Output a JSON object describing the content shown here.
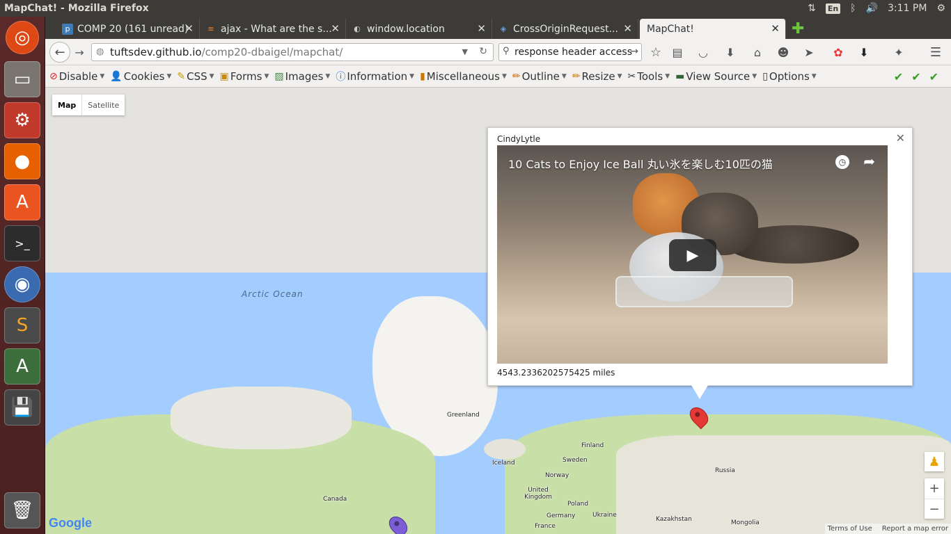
{
  "os": {
    "window_title": "MapChat! - Mozilla Firefox",
    "language": "En",
    "clock": "3:11 PM"
  },
  "tabs": [
    {
      "label": "COMP 20 (161 unread)",
      "icon": "piazza-icon"
    },
    {
      "label": "ajax - What are the s...",
      "icon": "stackoverflow-icon"
    },
    {
      "label": "window.location",
      "icon": "mdn-icon"
    },
    {
      "label": "CrossOriginRequest...",
      "icon": "site-icon"
    },
    {
      "label": "MapChat!",
      "icon": "none"
    }
  ],
  "nav": {
    "url_host": "tuftsdev.github.io",
    "url_path": "/comp20-dbaigel/mapchat/",
    "search_value": "response header access"
  },
  "devbar": {
    "items": [
      "Disable",
      "Cookies",
      "CSS",
      "Forms",
      "Images",
      "Information",
      "Miscellaneous",
      "Outline",
      "Resize",
      "Tools",
      "View Source",
      "Options"
    ]
  },
  "map": {
    "type_map": "Map",
    "type_satellite": "Satellite",
    "labels": {
      "arctic": "Arctic Ocean",
      "greenland": "Greenland",
      "iceland": "Iceland",
      "finland": "Finland",
      "sweden": "Sweden",
      "norway": "Norway",
      "russia": "Russia",
      "uk": "United Kingdom",
      "poland": "Poland",
      "germany": "Germany",
      "ukraine": "Ukraine",
      "france": "France",
      "kazakhstan": "Kazakhstan",
      "mongolia": "Mongolia",
      "canada": "Canada"
    },
    "terms": "Terms of Use",
    "report": "Report a map error",
    "logo": "Google"
  },
  "infowindow": {
    "username": "CindyLytle",
    "video_title": "10 Cats to Enjoy Ice Ball 丸い氷を楽しむ10匹の猫",
    "distance": "4543.2336202575425 miles"
  }
}
